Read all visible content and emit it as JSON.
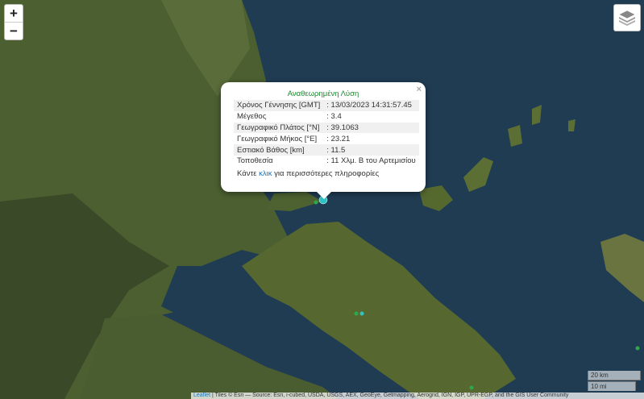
{
  "zoom": {
    "in_label": "+",
    "out_label": "−"
  },
  "icons": {
    "layers": "layers-icon",
    "close": "close-icon"
  },
  "popup": {
    "title": "Αναθεωρημένη Λύση",
    "close_label": "×",
    "rows": [
      {
        "label": "Χρόνος Γέννησης [GMT]",
        "value": ": 13/03/2023 14:31:57.45"
      },
      {
        "label": "Μέγεθος",
        "value": ": 3.4"
      },
      {
        "label": "Γεωγραφικό Πλάτος [°N]",
        "value": ": 39.1063"
      },
      {
        "label": "Γεωγραφικό Μήκος [°E]",
        "value": ": 23.21"
      },
      {
        "label": "Εστιακό Βάθος [km]",
        "value": ": 11.5"
      },
      {
        "label": "Τοποθεσία",
        "value": ": 11 Χλμ. Β του Αρτεμισίου"
      }
    ],
    "more_prefix": "Κάντε ",
    "more_link": "κλικ",
    "more_suffix": " για περισσότερες πληροφορίες"
  },
  "scale": {
    "km": "20 km",
    "mi": "10 mi"
  },
  "attribution": {
    "leaflet": "Leaflet",
    "text": " | Tiles © Esri — Source: Esri, i-cubed, USDA, USGS, AEX, GeoEye, Getmapping, Aerogrid, IGN, IGP, UPR-EGP, and the GIS User Community"
  },
  "colors": {
    "title_green": "#1d8a2e",
    "link_blue": "#1a73b8",
    "marker_cyan": "#2ec4c4",
    "marker_green": "#2ea84a",
    "sea": "#1f3a4f",
    "land": "#4f6a2e"
  }
}
